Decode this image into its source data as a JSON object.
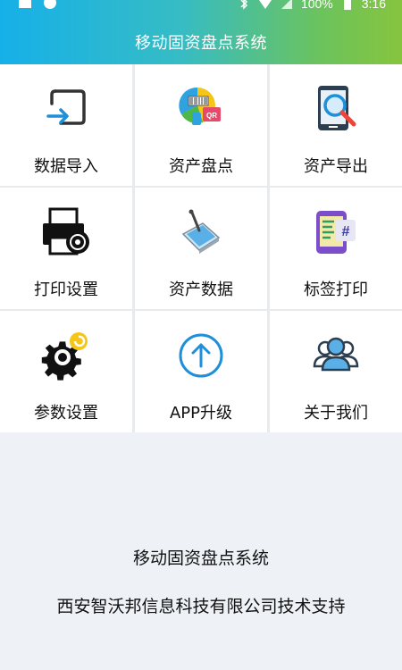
{
  "status_bar": {
    "battery": "100%",
    "time": "3:16",
    "icons": [
      "image-icon",
      "circle-icon",
      "bluetooth-icon",
      "wifi-icon",
      "signal-icon",
      "battery-icon"
    ]
  },
  "header": {
    "title": "移动固资盘点系统",
    "gradient_start": "#16b0e8",
    "gradient_end": "#86c43e"
  },
  "menu": {
    "items": [
      {
        "label": "数据导入",
        "icon": "import-icon"
      },
      {
        "label": "资产盘点",
        "icon": "inventory-scan-icon"
      },
      {
        "label": "资产导出",
        "icon": "export-search-icon"
      },
      {
        "label": "打印设置",
        "icon": "printer-settings-icon"
      },
      {
        "label": "资产数据",
        "icon": "asset-data-icon"
      },
      {
        "label": "标签打印",
        "icon": "label-print-icon"
      },
      {
        "label": "参数设置",
        "icon": "gear-icon"
      },
      {
        "label": "APP升级",
        "icon": "upgrade-arrow-icon"
      },
      {
        "label": "关于我们",
        "icon": "users-icon"
      }
    ]
  },
  "footer": {
    "app_name": "移动固资盘点系统",
    "support": "西安智沃邦信息科技有限公司技术支持"
  }
}
